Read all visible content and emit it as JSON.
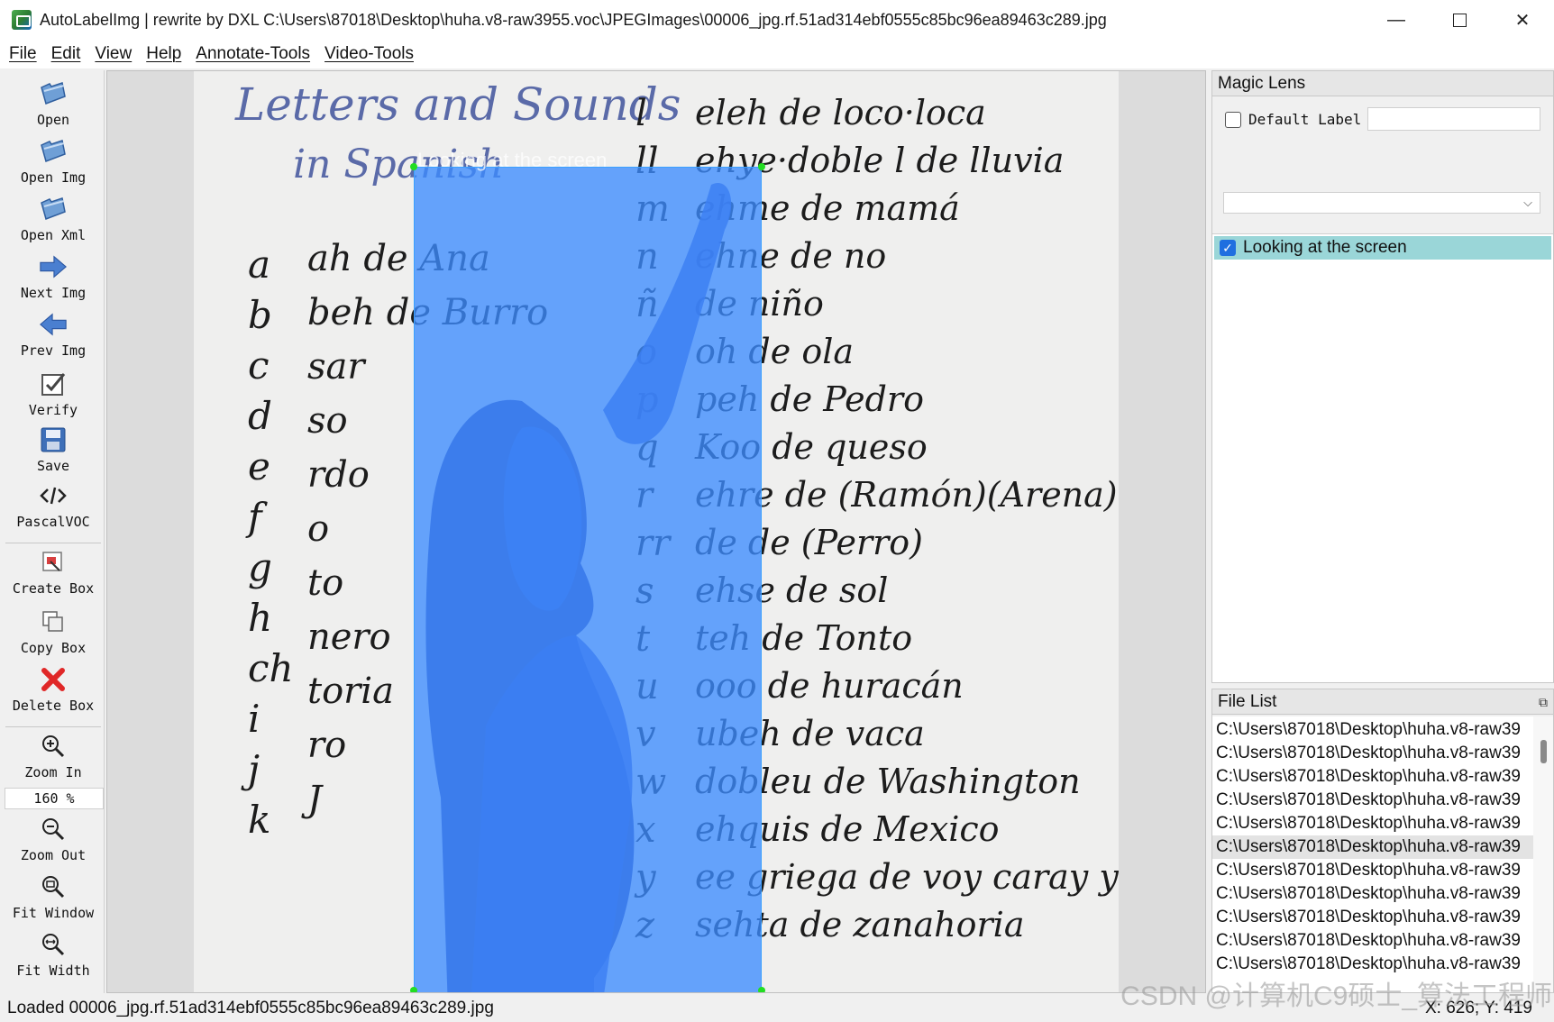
{
  "window": {
    "title": "AutoLabelImg | rewrite by DXL C:\\Users\\87018\\Desktop\\huha.v8-raw3955.voc\\JPEGImages\\00006_jpg.rf.51ad314ebf0555c85bc96ea89463c289.jpg",
    "controls": {
      "minimize": "—",
      "maximize": "",
      "close": "✕"
    }
  },
  "menu": [
    "File",
    "Edit",
    "View",
    "Help",
    "Annotate-Tools",
    "Video-Tools"
  ],
  "toolbar": {
    "open": "Open",
    "open_img": "Open Img",
    "open_xml": "Open Xml",
    "next_img": "Next Img",
    "prev_img": "Prev Img",
    "verify": "Verify",
    "save": "Save",
    "format": "PascalVOC",
    "create_box": "Create Box",
    "copy_box": "Copy Box",
    "delete_box": "Delete Box",
    "zoom_in": "Zoom In",
    "zoom_value": "160 %",
    "zoom_out": "Zoom Out",
    "fit_window": "Fit Window",
    "fit_width": "Fit Width"
  },
  "canvas": {
    "box_label": "Looking at the screen",
    "whiteboard": {
      "heading": "Letters and Sounds",
      "subheading": "in Spanish",
      "left_letters": [
        "a",
        "b",
        "c",
        "d",
        "e",
        "f",
        "g",
        "h",
        "ch",
        "i",
        "j",
        "k"
      ],
      "left_words": [
        "ah de Ana",
        "beh de Burro",
        "sar",
        "so",
        "rdo",
        "o",
        "to",
        "nero",
        "toria",
        "ro",
        "J"
      ],
      "right_letters": [
        "l",
        "ll",
        "m",
        "n",
        "ñ",
        "o",
        "p",
        "q",
        "r",
        "rr",
        "s",
        "t",
        "u",
        "v",
        "w",
        "x",
        "y",
        "z"
      ],
      "right_words": [
        "eleh de loco·loca",
        "ehye·doble l de lluvia",
        "ehme de mamá",
        "ehne de no",
        "de niño",
        "oh de ola",
        "peh de Pedro",
        "Koo de queso",
        "ehre de (Ramón)(Arena)",
        "de de (Perro)",
        "ehse de sol",
        "teh de Tonto",
        "ooo de huracán",
        "ubeh de vaca",
        "dobleu de Washington",
        "ehquis de Mexico",
        "ee griega de voy caray yo vaya",
        "sehta de zanahoria"
      ]
    }
  },
  "magic_lens": {
    "title": "Magic Lens",
    "default_label": "Default Label",
    "default_label_value": "",
    "combo_value": "",
    "labels": [
      {
        "text": "Looking at the screen",
        "checked": true
      }
    ]
  },
  "file_list": {
    "title": "File List",
    "files": [
      "C:\\Users\\87018\\Desktop\\huha.v8-raw39",
      "C:\\Users\\87018\\Desktop\\huha.v8-raw39",
      "C:\\Users\\87018\\Desktop\\huha.v8-raw39",
      "C:\\Users\\87018\\Desktop\\huha.v8-raw39",
      "C:\\Users\\87018\\Desktop\\huha.v8-raw39",
      "C:\\Users\\87018\\Desktop\\huha.v8-raw39",
      "C:\\Users\\87018\\Desktop\\huha.v8-raw39",
      "C:\\Users\\87018\\Desktop\\huha.v8-raw39",
      "C:\\Users\\87018\\Desktop\\huha.v8-raw39",
      "C:\\Users\\87018\\Desktop\\huha.v8-raw39",
      "C:\\Users\\87018\\Desktop\\huha.v8-raw39"
    ],
    "selected_index": 5
  },
  "status": {
    "message": "Loaded 00006_jpg.rf.51ad314ebf0555c85bc96ea89463c289.jpg",
    "coords": "X: 626; Y: 419"
  },
  "watermark": "CSDN @计算机C9硕士_算法工程师",
  "colors": {
    "box_fill": "#3c8cff",
    "box_handle": "#22dd22",
    "label_row": "#9ad6d8",
    "file_selected": "#e3e3e3"
  }
}
